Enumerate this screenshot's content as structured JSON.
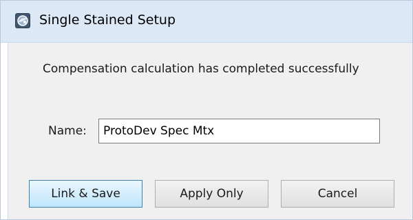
{
  "window": {
    "title": "Single Stained Setup",
    "icon": "app-icon"
  },
  "dialog": {
    "message": "Compensation calculation has completed successfully",
    "name_label": "Name:",
    "name_value": "ProtoDev Spec Mtx"
  },
  "buttons": {
    "link_save": "Link & Save",
    "apply_only": "Apply Only",
    "cancel": "Cancel"
  },
  "colors": {
    "titlebar": "#dce8f5",
    "client_background": "#f0f0f0",
    "default_button_border": "#3c7fb1"
  }
}
